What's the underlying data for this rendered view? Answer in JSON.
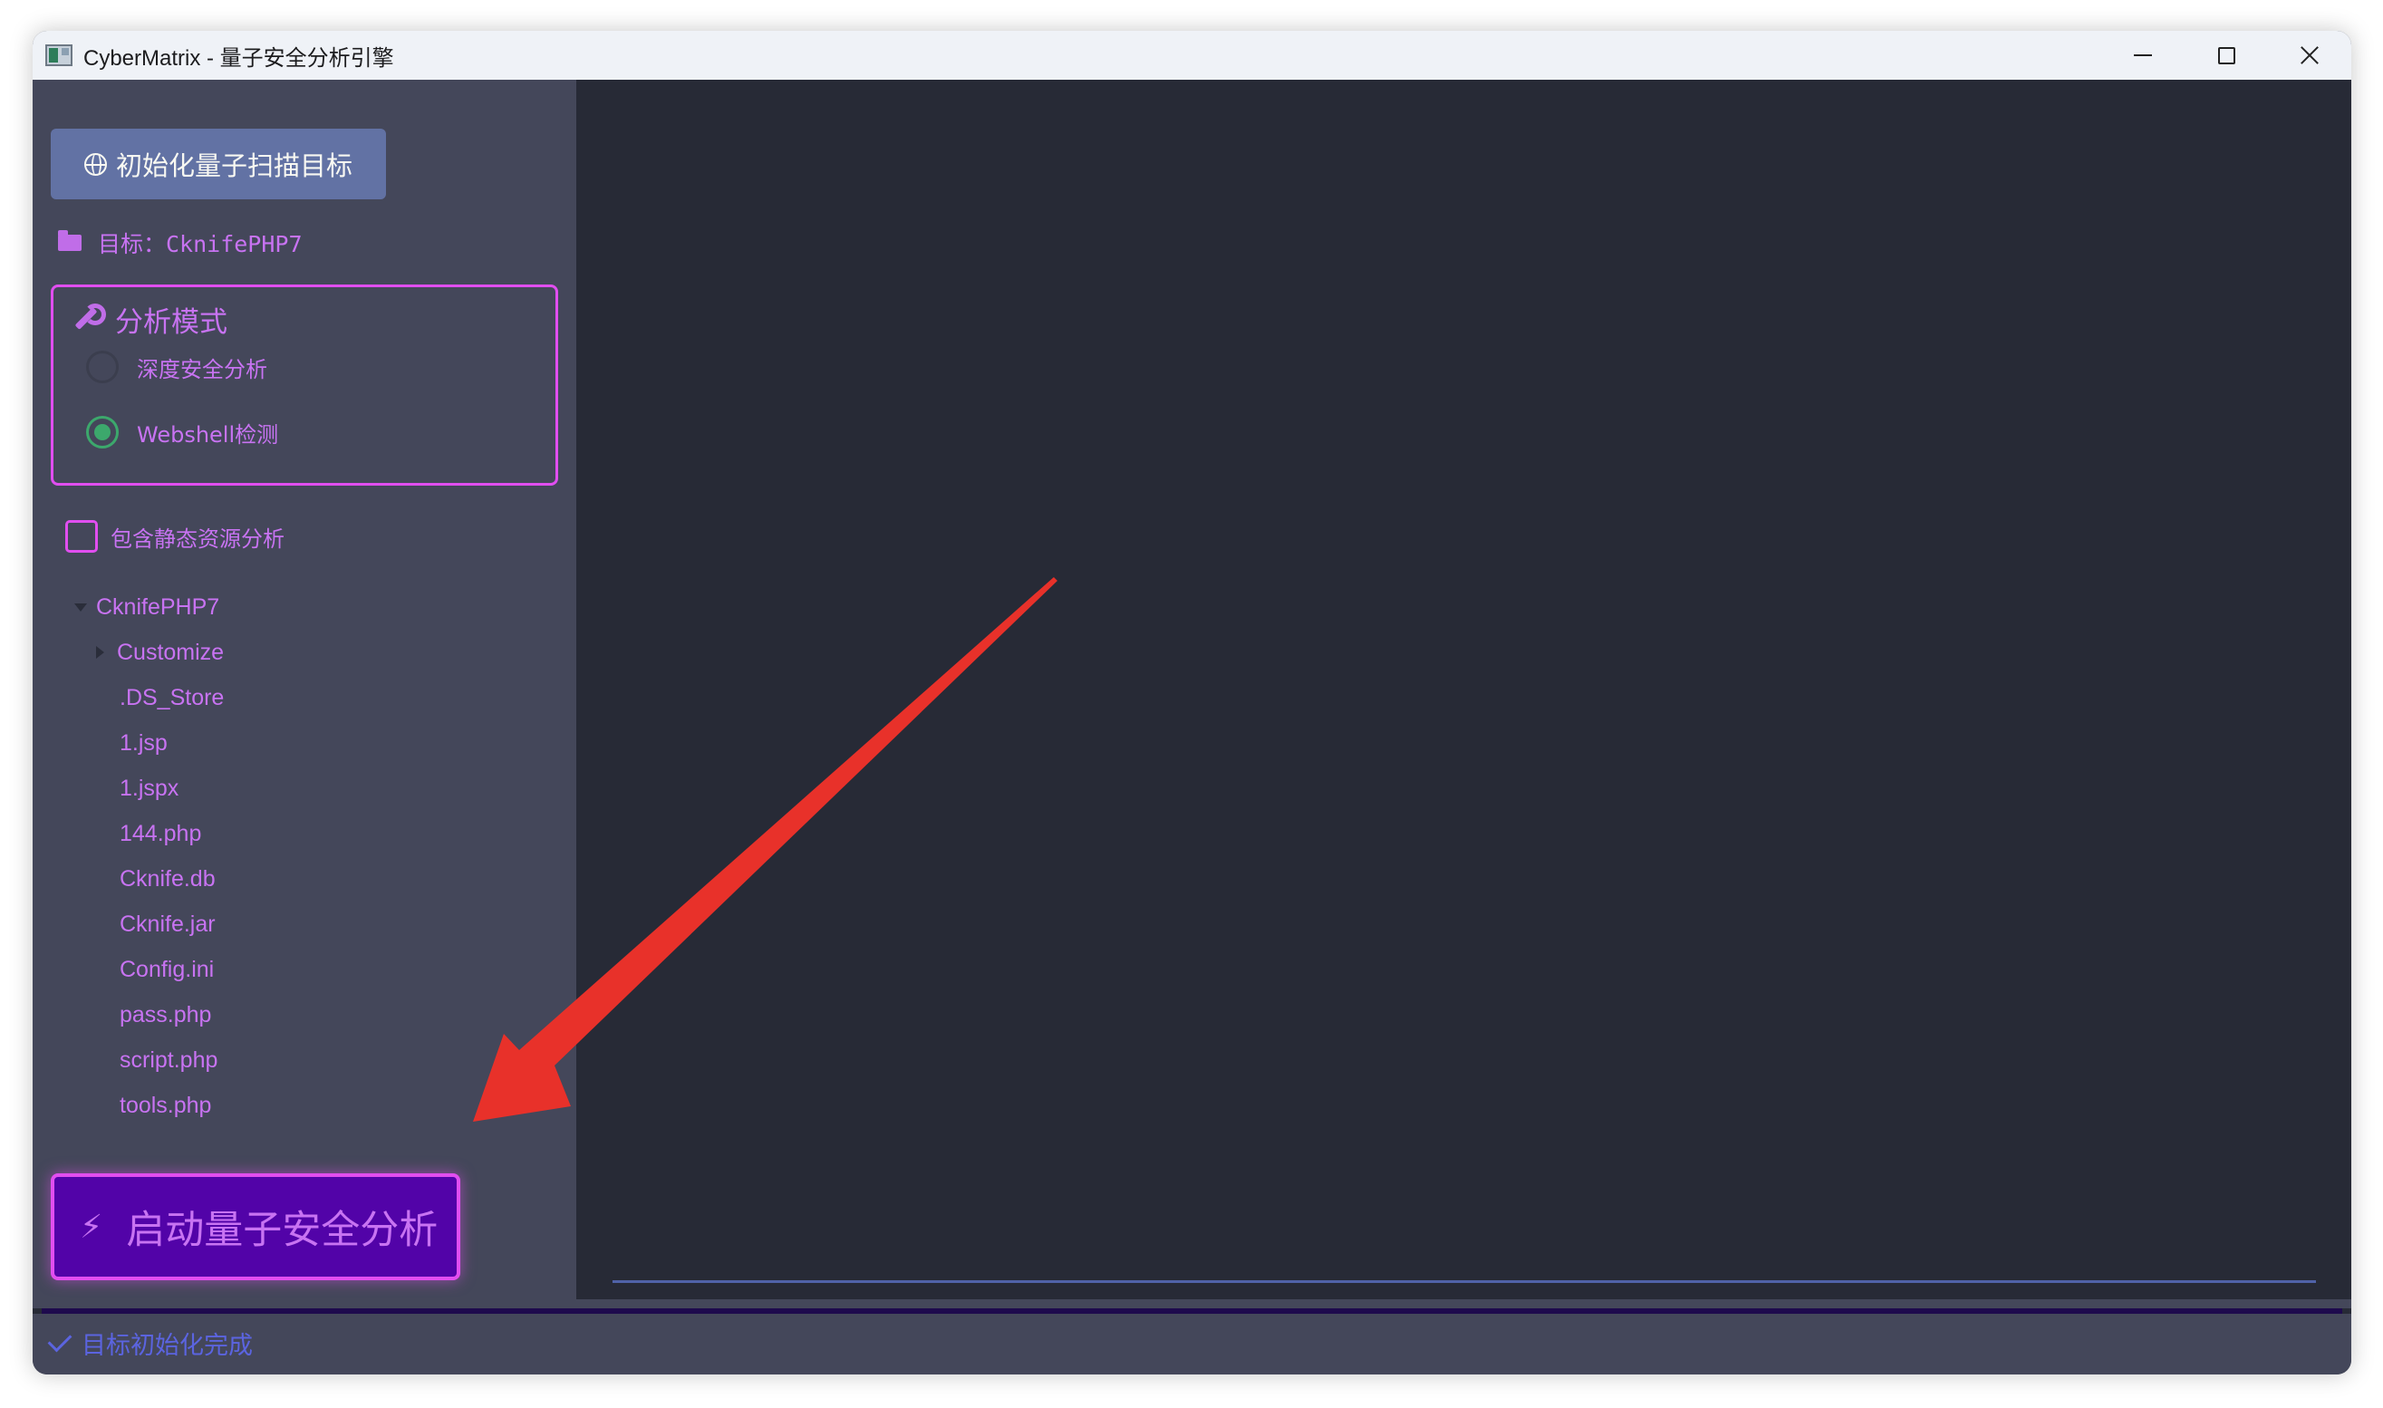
{
  "window": {
    "title": "CyberMatrix - 量子安全分析引擎"
  },
  "sidebar": {
    "init_button_label": "初始化量子扫描目标",
    "target_label": "目标：CknifePHP7",
    "mode_group": {
      "title": "分析模式",
      "options": [
        {
          "label": "深度安全分析",
          "selected": false
        },
        {
          "label": "Webshell检测",
          "selected": true
        }
      ]
    },
    "include_static_label": "包含静态资源分析",
    "include_static_checked": false,
    "tree": {
      "root": "CknifePHP7",
      "folders": [
        "Customize"
      ],
      "files": [
        ".DS_Store",
        "1.jsp",
        "1.jspx",
        "144.php",
        "Cknife.db",
        "Cknife.jar",
        "Config.ini",
        "pass.php",
        "script.php",
        "tools.php"
      ]
    },
    "start_button_label": "启动量子安全分析",
    "start_button_icon": "⚡"
  },
  "status_bar": {
    "text": "目标初始化完成"
  },
  "colors": {
    "sidebar_bg": "#44475a",
    "content_bg": "#272a36",
    "accent_magenta": "#e14ef0",
    "text_purple": "#c873f2",
    "button_blue": "#6272a4",
    "start_button_bg": "#5203a8",
    "radio_green": "#3ca86c",
    "status_blue": "#5b64e0",
    "annotation_arrow": "#e8312a"
  },
  "icons": {
    "app": "app-icon",
    "init_button": "globe-icon",
    "target": "folder-icon",
    "mode": "wrench-icon",
    "status": "check-icon",
    "start": "lightning-icon"
  }
}
